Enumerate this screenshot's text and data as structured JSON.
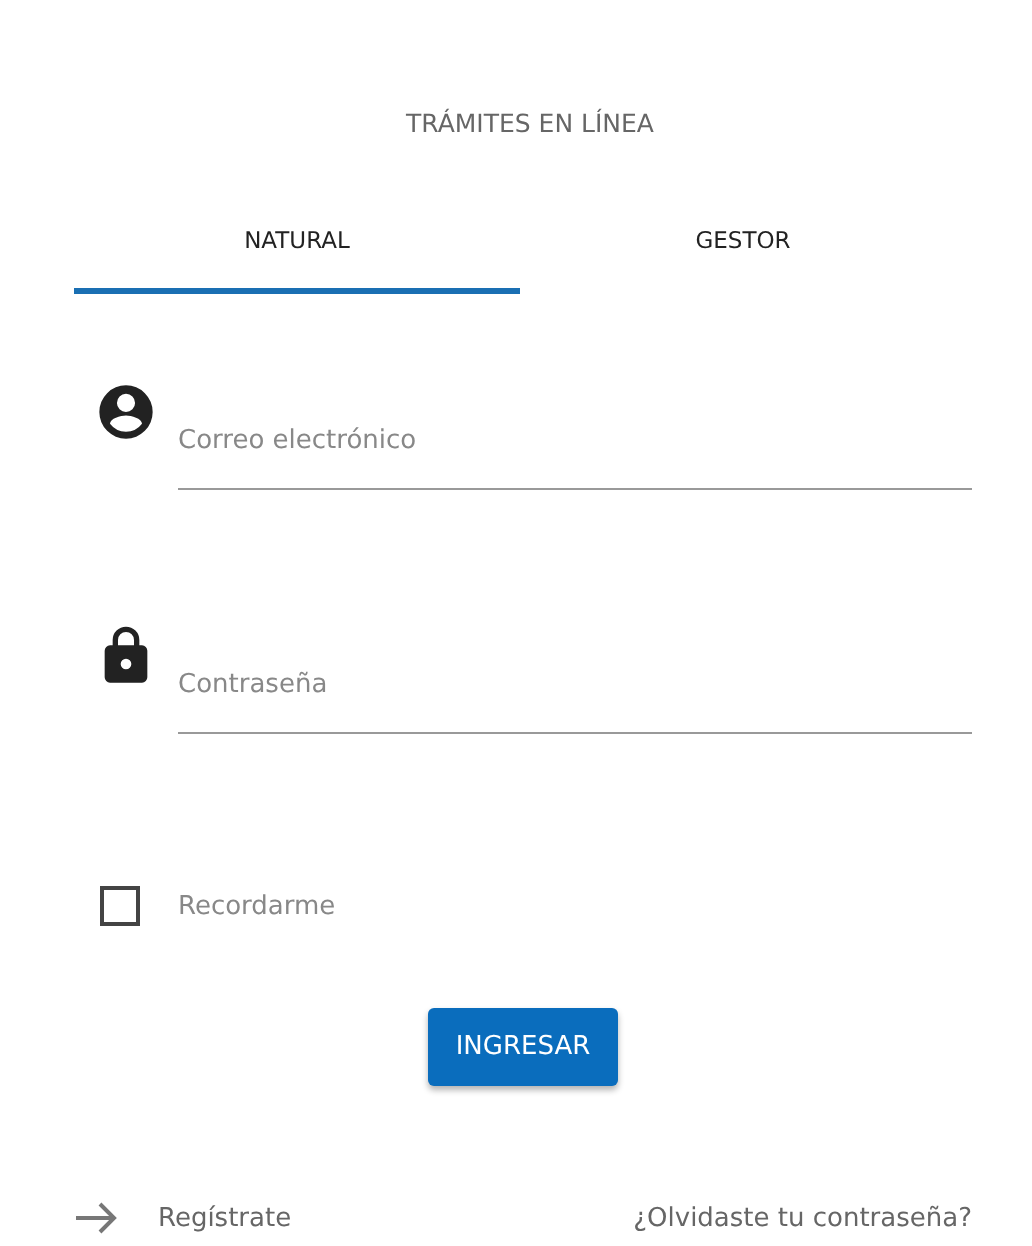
{
  "title": "TRÁMITES EN LÍNEA",
  "tabs": [
    {
      "label": "NATURAL",
      "selected": true
    },
    {
      "label": "GESTOR",
      "selected": false
    }
  ],
  "fields": [
    {
      "kind": "user",
      "placeholder": "Correo electrónico"
    },
    {
      "kind": "lock",
      "placeholder": "Contraseña"
    }
  ],
  "remember": {
    "label": "Recordarme",
    "checked": false
  },
  "submit": "INGRESAR",
  "register": "Regístrate",
  "forgot": "¿Olvidaste tu contraseña?"
}
